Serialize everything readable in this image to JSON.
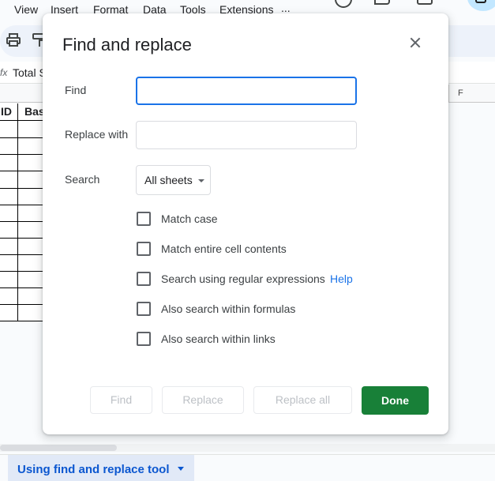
{
  "menu": {
    "items": [
      "View",
      "Insert",
      "Format",
      "Data",
      "Tools",
      "Extensions",
      "..."
    ]
  },
  "formula_bar": {
    "text": "Total S"
  },
  "column_header": {
    "f": "F"
  },
  "sheet": {
    "header_cells": [
      "ID",
      "Bas"
    ]
  },
  "sheet_tab": {
    "label": "Using find and replace tool"
  },
  "dialog": {
    "title": "Find and replace",
    "find_label": "Find",
    "find_value": "",
    "replace_label": "Replace with",
    "replace_value": "",
    "search_label": "Search",
    "search_value": "All sheets",
    "options": [
      {
        "label": "Match case",
        "checked": false
      },
      {
        "label": "Match entire cell contents",
        "checked": false
      },
      {
        "label": "Search using regular expressions",
        "checked": false
      },
      {
        "label": "Also search within formulas",
        "checked": false
      },
      {
        "label": "Also search within links",
        "checked": false
      }
    ],
    "help_link": "Help",
    "buttons": {
      "find": "Find",
      "replace": "Replace",
      "replace_all": "Replace all",
      "done": "Done"
    }
  },
  "colors": {
    "accent": "#1a73e8",
    "done_button": "#188038",
    "sheet_tab_text": "#0b57d0"
  }
}
